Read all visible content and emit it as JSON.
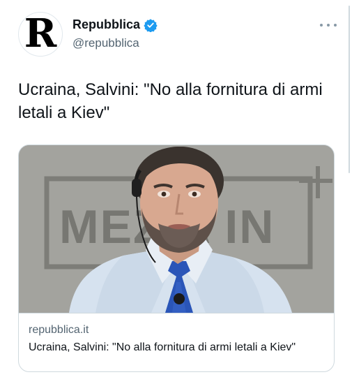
{
  "account": {
    "display_name": "Repubblica",
    "handle": "@repubblica",
    "avatar_letter": "R",
    "verified": true
  },
  "tweet": {
    "text": "Ucraina, Salvini: \"No alla fornitura di armi letali a Kiev\""
  },
  "link_card": {
    "image_overlay_text": "MEZ  A IN",
    "domain": "repubblica.it",
    "title": "Ucraina, Salvini: \"No alla fornitura di armi letali a Kiev\""
  },
  "colors": {
    "verified_blue": "#1d9bf0",
    "text_primary": "#0f1419",
    "text_secondary": "#536471",
    "border": "#cfd9de",
    "tie_blue": "#2a55b8"
  },
  "icons": {
    "verified": "verified-badge-icon",
    "more": "more-options-icon"
  }
}
